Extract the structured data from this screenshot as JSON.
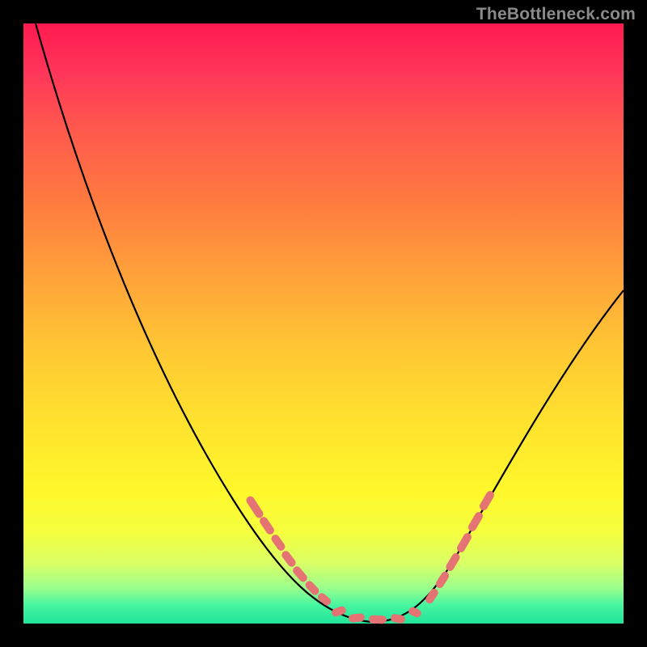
{
  "watermark": "TheBottleneck.com",
  "colors": {
    "dash": "#e57373",
    "curve": "#000000",
    "gradient_top": "#ff1a4f",
    "gradient_bottom": "#22e49a"
  },
  "chart_data": {
    "type": "line",
    "title": "",
    "xlabel": "",
    "ylabel": "",
    "xlim": [
      0,
      100
    ],
    "ylim": [
      0,
      100
    ],
    "series": [
      {
        "name": "bottleneck-curve",
        "x": [
          2,
          6,
          10,
          14,
          18,
          22,
          26,
          30,
          34,
          38,
          42,
          46,
          50,
          53,
          56,
          59,
          62,
          65,
          68,
          72,
          76,
          80,
          84,
          88,
          92,
          96,
          100
        ],
        "y": [
          100,
          93,
          86,
          79,
          72,
          64,
          56,
          48,
          40,
          32,
          24,
          16,
          9,
          4,
          1,
          0,
          0,
          1,
          4,
          10,
          18,
          26,
          33,
          40,
          46,
          51,
          55
        ]
      }
    ],
    "dash_highlights": {
      "left_branch_approx_x_range": [
        38,
        50
      ],
      "right_branch_approx_x_range": [
        65,
        75
      ],
      "bottom_approx_x_range": [
        50,
        65
      ]
    }
  }
}
